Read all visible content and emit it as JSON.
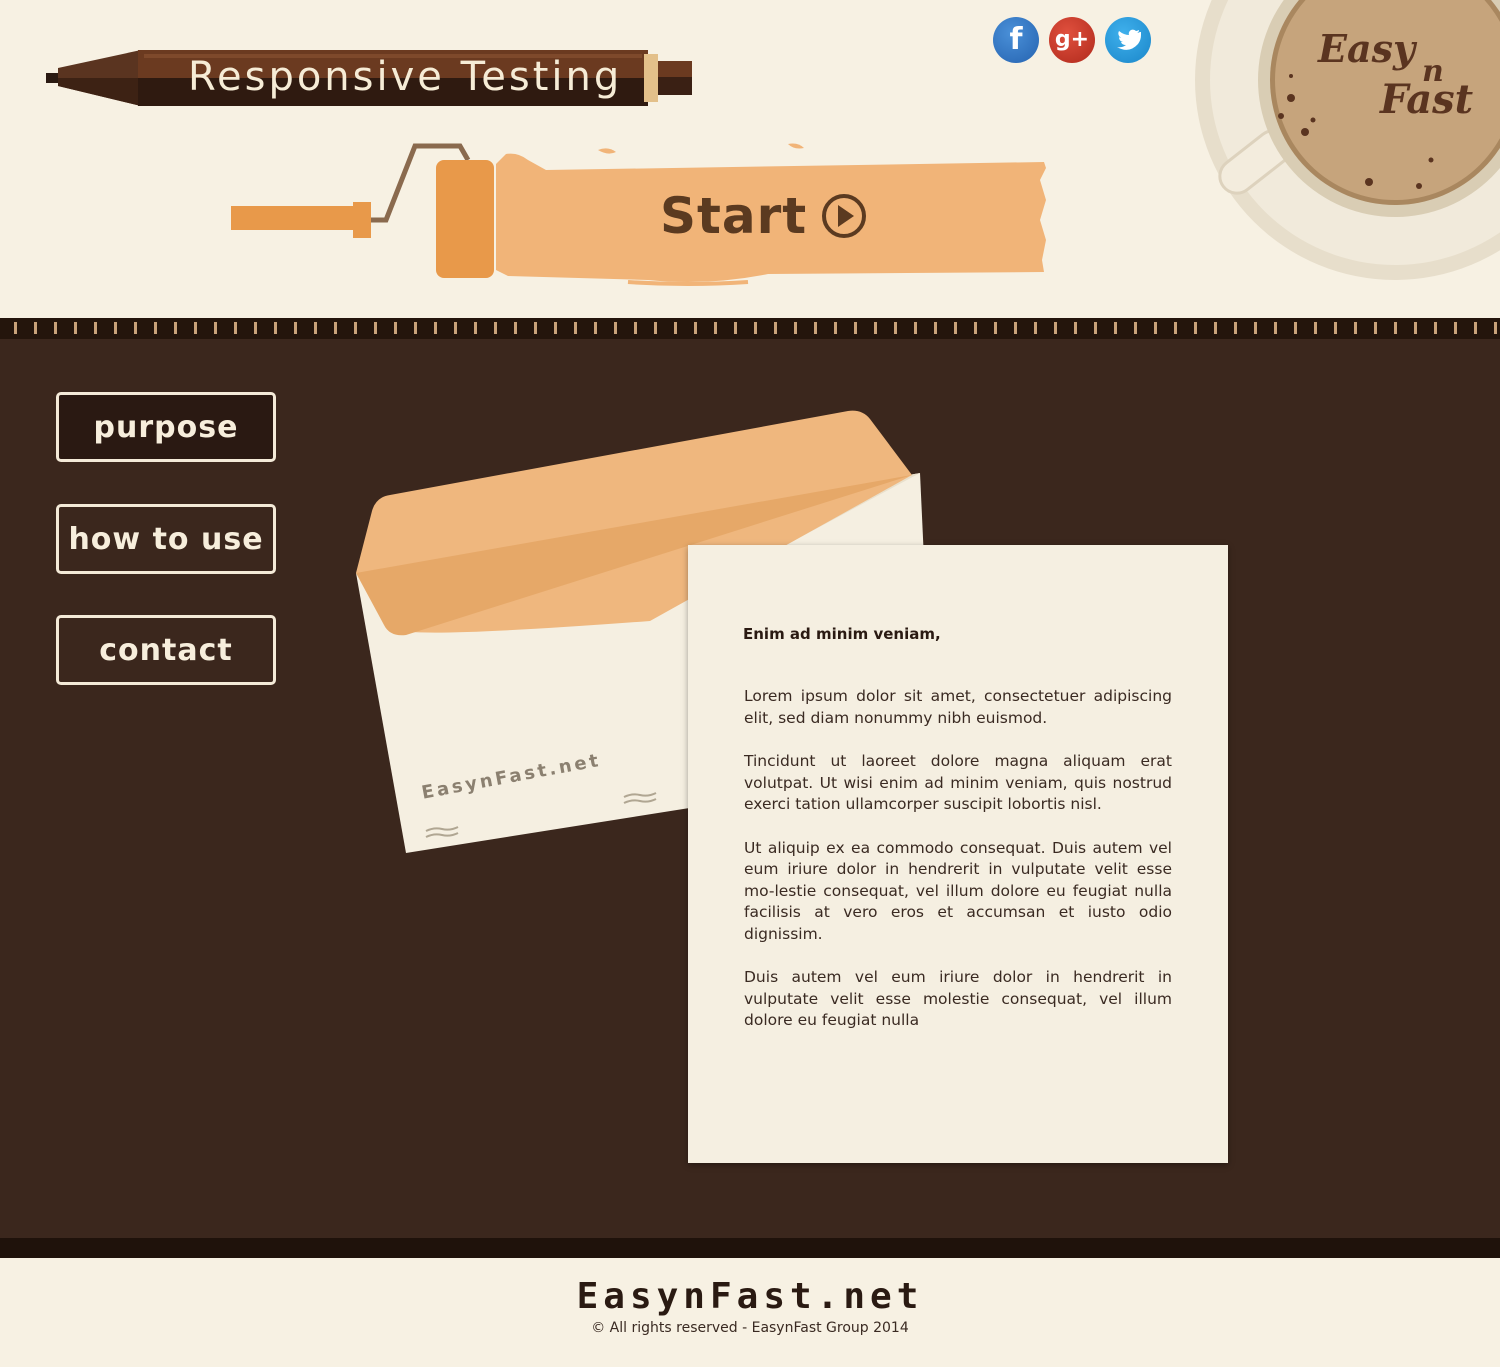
{
  "header": {
    "title": "Responsive Testing",
    "start_label": "Start",
    "social": [
      {
        "name": "facebook",
        "glyph": "f",
        "icon": "facebook-icon",
        "color": "#3b7dcc"
      },
      {
        "name": "google-plus",
        "glyph": "g+",
        "icon": "google-plus-icon",
        "color": "#c9382a"
      },
      {
        "name": "twitter",
        "icon": "twitter-icon",
        "color": "#29a0e0"
      }
    ],
    "logo": {
      "line1": "Easy",
      "line2": "n",
      "line3": "Fast"
    }
  },
  "nav": {
    "items": [
      {
        "label": "purpose"
      },
      {
        "label": "how to use"
      },
      {
        "label": "contact"
      }
    ]
  },
  "envelope": {
    "brand": "EasynFast.net"
  },
  "letter": {
    "greeting": "Enim ad minim veniam,",
    "paragraphs": [
      "Lorem ipsum dolor sit amet, consectetuer adipiscing elit, sed diam nonummy nibh euismod.",
      "Tincidunt ut laoreet dolore magna aliquam erat volutpat. Ut wisi enim ad minim veniam, quis nostrud exerci tation ullamcorper suscipit lobortis nisl.",
      "Ut aliquip ex ea commodo consequat. Duis autem vel eum iriure dolor in hendrerit in vulputate velit esse mo-lestie consequat, vel illum dolore eu feugiat nulla facilisis at vero eros et accumsan et iusto odio dignissim.",
      "Duis autem vel eum iriure dolor in hendrerit in vulputate velit esse molestie consequat, vel illum dolore eu feugiat nulla"
    ]
  },
  "footer": {
    "brand": "EasynFast.net",
    "copyright": "©  All rights reserved - EasynFast Group 2014"
  },
  "colors": {
    "cream": "#f7f1e3",
    "dark_brown": "#3b271d",
    "orange": "#e8994a",
    "light_orange": "#f1b478"
  }
}
